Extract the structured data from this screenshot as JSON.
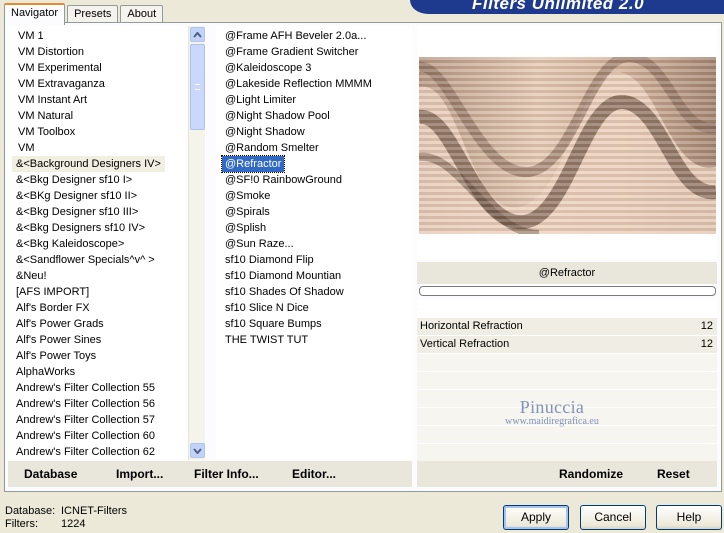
{
  "brand": {
    "title": "Filters Unlimited 2.0"
  },
  "tabs": [
    {
      "label": "Navigator",
      "active": true
    },
    {
      "label": "Presets",
      "active": false
    },
    {
      "label": "About",
      "active": false
    }
  ],
  "categories": [
    "VM 1",
    "VM Distortion",
    "VM Experimental",
    "VM Extravaganza",
    "VM Instant Art",
    "VM Natural",
    "VM Toolbox",
    "VM",
    "&<Background Designers IV>",
    "&<Bkg Designer sf10 I>",
    "&<BKg Designer sf10 II>",
    "&<Bkg Designer sf10 III>",
    "&<Bkg Designers sf10 IV>",
    "&<Bkg Kaleidoscope>",
    "&<Sandflower Specials^v^ >",
    "&Neu!",
    "[AFS IMPORT]",
    "Alf's Border FX",
    "Alf's Power Grads",
    "Alf's Power Sines",
    "Alf's Power Toys",
    "AlphaWorks",
    "Andrew's Filter Collection 55",
    "Andrew's Filter Collection 56",
    "Andrew's Filter Collection 57",
    "Andrew's Filter Collection 60",
    "Andrew's Filter Collection 62"
  ],
  "selected_category_index": 8,
  "filters": [
    "@Frame AFH Beveler 2.0a...",
    "@Frame Gradient Switcher",
    "@Kaleidoscope 3",
    "@Lakeside Reflection MMMM",
    "@Light Limiter",
    "@Night Shadow Pool",
    "@Night Shadow",
    "@Random Smelter",
    "@Refractor",
    "@SF!0 RainbowGround",
    "@Smoke",
    "@Spirals",
    "@Splish",
    "@Sun Raze...",
    "sf10 Diamond Flip",
    "sf10 Diamond Mountian",
    "sf10 Shades Of Shadow",
    "sf10 Slice N Dice",
    "sf10 Square Bumps",
    "THE TWIST TUT"
  ],
  "selected_filter_index": 8,
  "preview": {
    "filter_name": "@Refractor",
    "params": [
      {
        "label": "Horizontal Refraction",
        "value": "12"
      },
      {
        "label": "Vertical Refraction",
        "value": "12"
      }
    ],
    "colors": {
      "light": "#efd7c3",
      "mid": "#c9a489",
      "dark": "#6e5444"
    }
  },
  "watermark": {
    "name": "Pinuccia",
    "site": "www.maidiregrafica.eu"
  },
  "left_buttons": [
    "Database",
    "Import...",
    "Filter Info...",
    "Editor..."
  ],
  "right_buttons": [
    "Randomize",
    "Reset"
  ],
  "status": {
    "database_label": "Database:",
    "database_value": "ICNET-Filters",
    "filters_label": "Filters:",
    "filters_value": "1224"
  },
  "dialog_buttons": {
    "apply": "Apply",
    "cancel": "Cancel",
    "help": "Help"
  }
}
